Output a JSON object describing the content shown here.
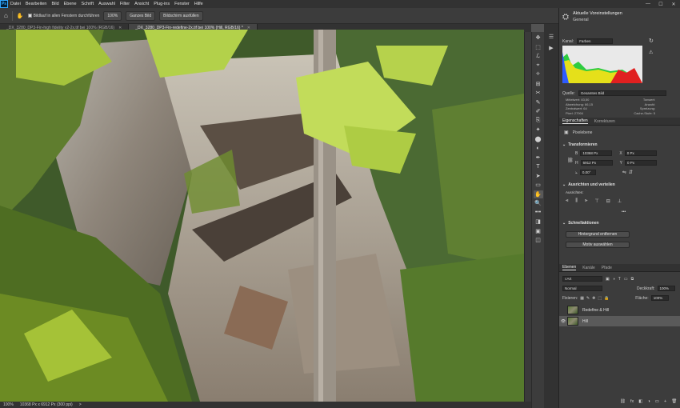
{
  "app": {
    "logo": "Ps"
  },
  "menu": [
    "Datei",
    "Bearbeiten",
    "Bild",
    "Ebene",
    "Schrift",
    "Auswahl",
    "Filter",
    "Ansicht",
    "Plug-ins",
    "Fenster",
    "Hilfe"
  ],
  "window_controls": [
    "—",
    "☐",
    "✕"
  ],
  "options": {
    "scroll_all_label": "Bildlauf in allen Fenstern durchführen",
    "zoom_btn": "100%",
    "fit_btn": "Ganzes Bild",
    "fill_btn": "Bildschirm ausfüllen"
  },
  "tabs": [
    {
      "label": "_DX_3280_DP3-Fin-high fidelity v2-2x.tif bei 100% (RGB/16)",
      "close": "✕"
    },
    {
      "label": "_DX_3280_DP3-Fin-redefine-2x.tif bei 100% (Hill, RGB/16) *",
      "close": "✕"
    }
  ],
  "status": {
    "zoom": "100%",
    "size": "10368 Px x 6912 Px (300 ppi)",
    "arrow": ">"
  },
  "presets": {
    "title": "Aktuelle Voreinstellungen",
    "subtitle": "General"
  },
  "histogram": {
    "channel_label": "Kanal:",
    "channel_value": "Farben",
    "source_label": "Quelle:",
    "source_value": "Gesamtes Bild",
    "stats_left": [
      {
        "k": "Mittelwert:",
        "v": "83,50"
      },
      {
        "k": "Abweichung:",
        "v": "66,15"
      },
      {
        "k": "Zentralwert:",
        "v": "64"
      },
      {
        "k": "Pixel:",
        "v": "27904"
      }
    ],
    "stats_right": [
      "Tonwert:",
      "Anzahl:",
      "Spreizung:",
      "Cache-Stufe: 5"
    ],
    "colors": {
      "red": "#e02020",
      "green": "#2ecc40",
      "yellow": "#e5e01a",
      "blue": "#2d5bff"
    }
  },
  "properties": {
    "tabs": [
      "Eigenschaften",
      "Korrekturen"
    ],
    "type": "Pixelebene",
    "transform_title": "Transformieren",
    "w_label": "B",
    "w_value": "10368 Px",
    "x_label": "X",
    "x_value": "0 Px",
    "h_label": "H",
    "h_value": "6912 Px",
    "y_label": "Y",
    "y_value": "0 Px",
    "angle": "0,00°",
    "align_title": "Ausrichten und verteilen",
    "align_sub": "Ausrichten:",
    "more": "•••",
    "quick_title": "Schnellaktionen",
    "btn_remove_bg": "Hintergrund entfernen",
    "btn_select_subject": "Motiv auswählen"
  },
  "layers": {
    "tabs": [
      "Ebenen",
      "Kanäle",
      "Pfade"
    ],
    "filter": "Art",
    "blend": "Normal",
    "opacity_label": "Deckkraft:",
    "opacity": "100%",
    "lock_label": "Fixieren:",
    "fill_label": "Fläche:",
    "fill": "100%",
    "items": [
      {
        "name": "Redefine & Hill",
        "visible": false
      },
      {
        "name": "Hill",
        "visible": true,
        "selected": true
      }
    ],
    "footer_icons": [
      "⛓",
      "fx",
      "◧",
      "◑",
      "▭",
      "+",
      "🗑"
    ]
  },
  "toolbar_icons": [
    "✥",
    "⬚",
    "ℒ",
    "⌖",
    "⟡",
    "⊞",
    "✂",
    "✎",
    "✐",
    "⎘",
    "✦",
    "⬤",
    "◐",
    "✒",
    "T",
    "➤",
    "▭",
    "✋",
    "🔍",
    "•••",
    "◨",
    "▣",
    "◫"
  ]
}
